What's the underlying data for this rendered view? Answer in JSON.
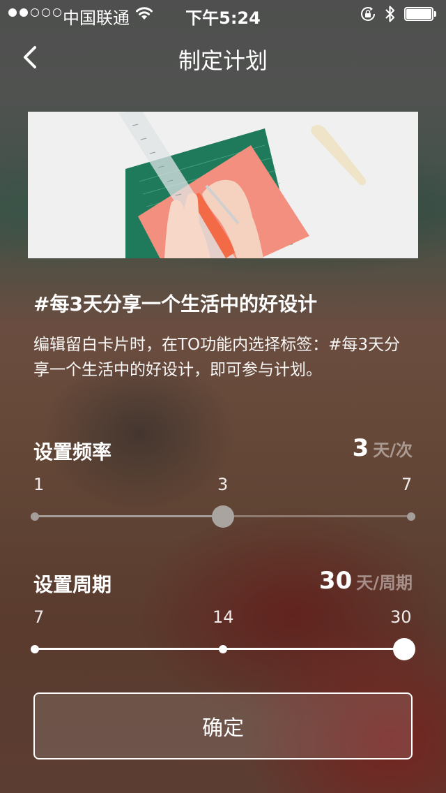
{
  "status_bar": {
    "carrier": "中国联通",
    "time": "下午5:24",
    "signal_strength": 2,
    "signal_max": 5,
    "battery_level": 1.0,
    "icons": [
      "wifi-icon",
      "rotation-lock-icon",
      "bluetooth-icon",
      "battery-icon"
    ]
  },
  "nav": {
    "title": "制定计划",
    "back_icon": "chevron-left-icon"
  },
  "banner": {
    "image": "crafting-illustration"
  },
  "plan": {
    "title": "#每3天分享一个生活中的好设计",
    "description": "编辑留白卡片时，在TO功能内选择标签：#每3天分享一个生活中的好设计，即可参与计划。"
  },
  "frequency": {
    "label": "设置频率",
    "value": "3",
    "unit": "天/次",
    "min_label": "1",
    "mid_label": "3",
    "max_label": "7",
    "min": 1,
    "max": 7,
    "current": 3
  },
  "period": {
    "label": "设置周期",
    "value": "30",
    "unit": "天/周期",
    "min_label": "7",
    "mid_label": "14",
    "max_label": "30",
    "stops": [
      7,
      14,
      30
    ],
    "current": 30
  },
  "confirm": {
    "label": "确定"
  },
  "colors": {
    "text": "#ffffff",
    "unit_text": "#b7a9a2",
    "frequency_track": "#9a9390",
    "period_track": "#ffffff"
  }
}
